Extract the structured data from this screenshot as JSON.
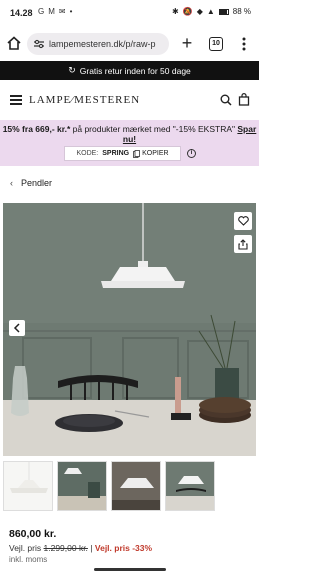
{
  "statusbar": {
    "time": "14.28",
    "left_icons": [
      "G",
      "M",
      "✉",
      "•"
    ],
    "battery_text": "88 %"
  },
  "browser": {
    "url": "lampemesteren.dk/p/raw-p",
    "tab_count": "10"
  },
  "promo_bar": {
    "text": "Gratis retur inden for 50 dage"
  },
  "header": {
    "logo_text": "LAMPE⁄MESTEREN"
  },
  "discount": {
    "pre": "15% fra 669,- kr.*",
    "mid": " på produkter mærket med \"-15% EKSTRA\" ",
    "link": "Spar nu!",
    "code_label": "KODE:",
    "code": "SPRING",
    "copy_label": "KOPIER"
  },
  "breadcrumb": {
    "label": "Pendler"
  },
  "product": {
    "price": "860,00 kr.",
    "veil_label": "Vejl. pris",
    "veil_price": "1.299,00 kr.",
    "separator": "|",
    "discount_label": "Vejl. pris -33%",
    "moms": "inkl. moms"
  },
  "colors": {
    "promo_black": "#111111",
    "discount_bg": "#ecd9ee",
    "discount_red": "#c0392b",
    "wall": "#6e7a72"
  }
}
